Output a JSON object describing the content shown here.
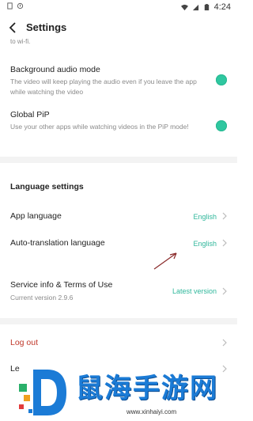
{
  "status_bar": {
    "time": "4:24"
  },
  "header": {
    "title": "Settings"
  },
  "partial_top_text": "to wi-fi.",
  "playback": {
    "background_audio": {
      "title": "Background audio mode",
      "description": "The video will keep playing the audio even if you leave the app while watching the video",
      "enabled": true
    },
    "global_pip": {
      "title": "Global PiP",
      "description": "Use your other apps while watching videos in the PiP mode!",
      "enabled": true
    }
  },
  "language": {
    "section_title": "Language settings",
    "app_language": {
      "label": "App language",
      "value": "English"
    },
    "auto_translation": {
      "label": "Auto-translation language",
      "value": "English"
    }
  },
  "service": {
    "title": "Service info & Terms of Use",
    "version": "Current version 2.9.6",
    "value": "Latest version"
  },
  "account": {
    "logout": "Log out",
    "leave_partial": "Le"
  },
  "watermark": {
    "text": "鼠海手游网",
    "url": "www.xinhaiyi.com"
  },
  "colors": {
    "accent": "#2fc7a0",
    "link": "#2fb79b"
  }
}
